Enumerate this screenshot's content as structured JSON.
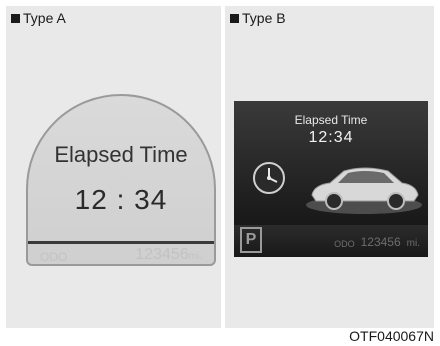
{
  "panel_a": {
    "label": "Type A",
    "gauge": {
      "title": "Elapsed Time",
      "time": "12 : 34",
      "odo_label": "ODO",
      "odo_value": "123456",
      "odo_unit": "mi."
    }
  },
  "panel_b": {
    "label": "Type B",
    "display": {
      "title": "Elapsed Time",
      "time": "12:34",
      "parking_letter": "P",
      "odo_label": "ODO",
      "odo_value": "123456",
      "odo_unit": "mi."
    }
  },
  "figure_code": "OTF040067N",
  "icons": [
    "square-bullet-icon",
    "clock-icon",
    "car-image",
    "parking-icon"
  ]
}
